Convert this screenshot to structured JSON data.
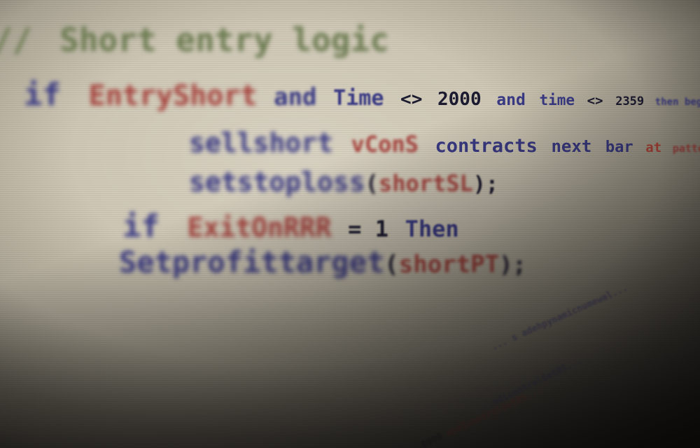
{
  "code_lines": {
    "l1": {
      "gutter": "//",
      "comment": "Short entry logic"
    },
    "l2": {
      "kw_if": "if",
      "var": "EntryShort",
      "kw_and": "and",
      "kw_time": "Time",
      "op_ne": "<>",
      "num_2000": "2000",
      "kw_and2": "and",
      "kw_time2": "time",
      "op_ne2": "<>",
      "num_2359": "2359",
      "tail": "then begin"
    },
    "l3": {
      "kw_sellshort": "sellshort",
      "var": "vConS",
      "kw_contracts": "contracts",
      "kw_next": "next",
      "kw_bar": "bar",
      "kw_at": "at",
      "tail": "patternshortt..."
    },
    "l4": {
      "fn": "setstoploss",
      "open": "(",
      "arg": "shortSL",
      "close": ");"
    },
    "l5": {
      "kw_if": "if",
      "var": "ExitOnRRR",
      "op": "= 1",
      "kw_then": "Then"
    },
    "l6": {
      "fn": "Setprofittarget",
      "open": "(",
      "arg": "shortPT",
      "close": ");"
    },
    "l7": {
      "text": "... s adehpynamicnumewal..."
    },
    "l8": {
      "text": "...ndicontrolGetBS..."
    },
    "l9": {
      "text": "0000",
      "var": "endIcontrolGetBS..."
    }
  }
}
